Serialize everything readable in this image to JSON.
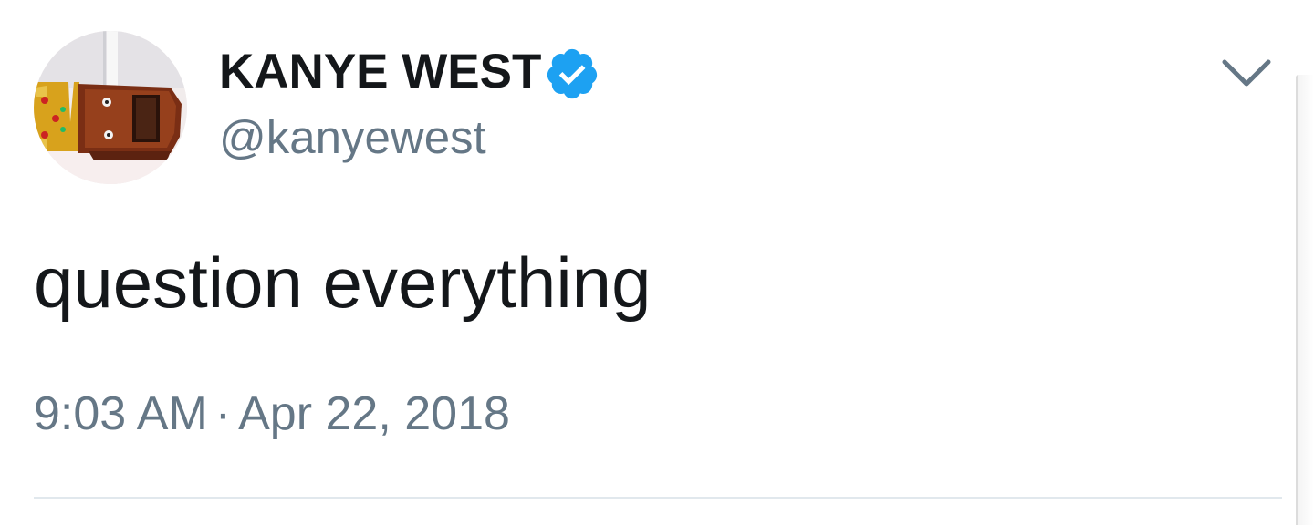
{
  "tweet": {
    "display_name": "KANYE WEST",
    "handle": "@kanyewest",
    "text": "question everything",
    "time": "9:03 AM",
    "separator": "·",
    "date": "Apr 22, 2018",
    "verified": true
  },
  "colors": {
    "text_primary": "#14171a",
    "text_secondary": "#657786",
    "verified_blue": "#1da1f2",
    "divider": "#e1e8ed"
  },
  "icons": {
    "verified": "verified-badge-icon",
    "menu": "chevron-down-icon"
  }
}
